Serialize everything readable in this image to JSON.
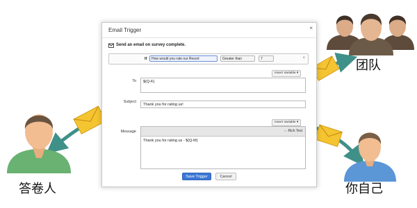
{
  "dialog": {
    "title": "Email Trigger",
    "close_glyph": "×",
    "subtitle": "Send an email on survey complete.",
    "condition": {
      "if_label": "If",
      "question": "How would you rate our Resort",
      "operator": "Greater than",
      "value": "7",
      "remove_glyph": "×"
    },
    "to": {
      "insert_variable": "Insert Variable ▾",
      "label": "To",
      "value": "$(Q-K)"
    },
    "subject": {
      "label": "Subject",
      "value": "Thank you for rating us!"
    },
    "message": {
      "insert_variable": "Insert Variable ▾",
      "label": "Message",
      "rich_text": "⇔ Rich Text",
      "body": "Thank you for rating us - $(Q-M)"
    },
    "buttons": {
      "save": "Save Trigger",
      "cancel": "Cancel"
    }
  },
  "figure": {
    "respondent_label": "答卷人",
    "team_label": "团队",
    "self_label": "你自己"
  },
  "colors": {
    "arrow": "#3f9089",
    "envelope": "#f5c431",
    "save_button": "#3b77d6",
    "respondent_shirt": "#69b272",
    "team_shirt": "#6c5a48",
    "self_shirt": "#5b96d6"
  },
  "icons": [
    "mail-icon",
    "close-icon",
    "envelope-icon",
    "person-icon"
  ]
}
